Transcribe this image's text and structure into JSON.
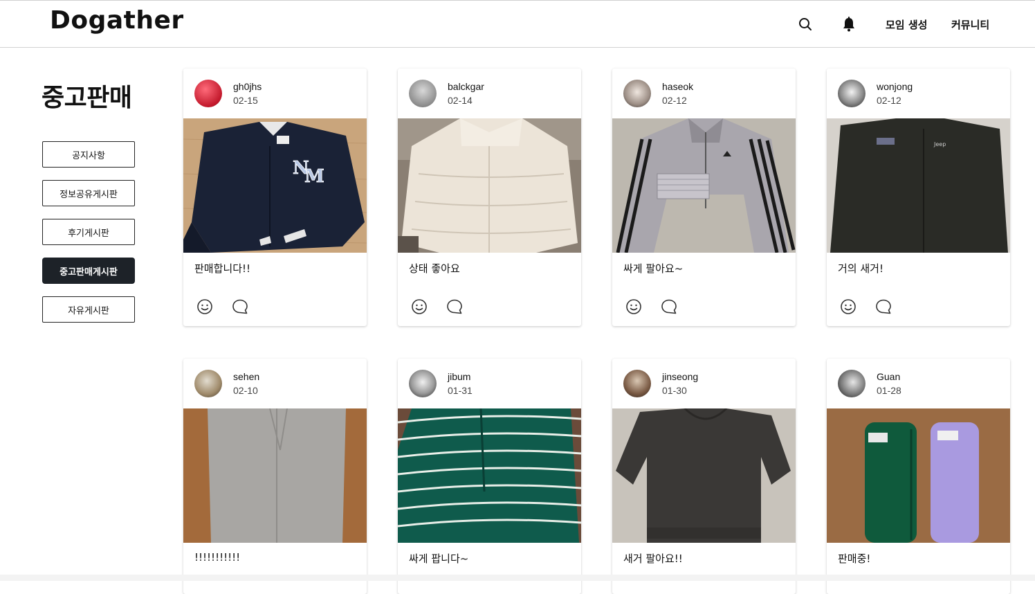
{
  "header": {
    "logo": "Dogather",
    "nav": [
      {
        "label": "모임 생성"
      },
      {
        "label": "커뮤니티"
      }
    ]
  },
  "page": {
    "title": "중고판매"
  },
  "sidebar": {
    "items": [
      {
        "label": "공지사항",
        "active": false
      },
      {
        "label": "정보공유게시판",
        "active": false
      },
      {
        "label": "후기게시판",
        "active": false
      },
      {
        "label": "중고판매게시판",
        "active": true
      },
      {
        "label": "자유게시판",
        "active": false
      }
    ]
  },
  "posts": [
    {
      "user": "gh0jhs",
      "date": "02-15",
      "text": "판매합니다!!"
    },
    {
      "user": "balckgar",
      "date": "02-14",
      "text": "상태 좋아요"
    },
    {
      "user": "haseok",
      "date": "02-12",
      "text": "싸게 팔아요~"
    },
    {
      "user": "wonjong",
      "date": "02-12",
      "text": "거의 새거!"
    },
    {
      "user": "sehen",
      "date": "02-10",
      "text": "!!!!!!!!!!!"
    },
    {
      "user": "jibum",
      "date": "01-31",
      "text": "싸게 팝니다~"
    },
    {
      "user": "jinseong",
      "date": "01-30",
      "text": "새거 팔아요!!"
    },
    {
      "user": "Guan",
      "date": "01-28",
      "text": "판매중!"
    }
  ],
  "colors": {
    "active_button_bg": "#1d2228",
    "text": "#111111"
  },
  "icons": [
    "search-icon",
    "bell-icon",
    "smile-icon",
    "comment-icon"
  ]
}
